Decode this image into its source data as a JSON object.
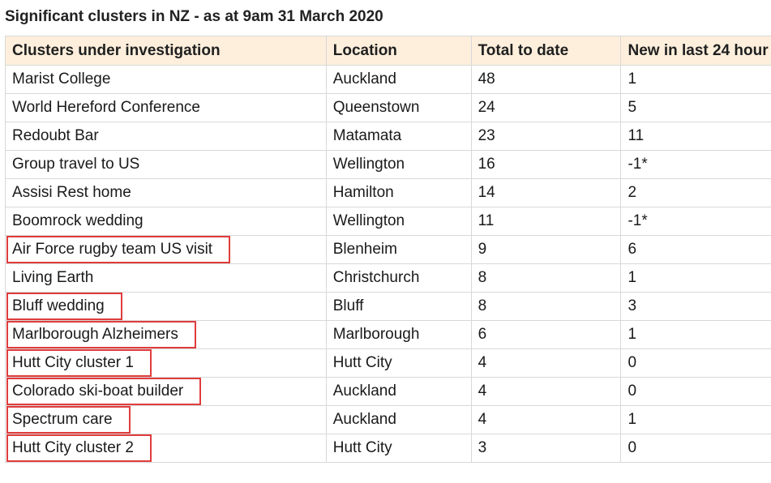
{
  "title": "Significant clusters in NZ - as at 9am 31 March 2020",
  "table": {
    "headers": [
      "Clusters under investigation",
      "Location",
      "Total to date",
      "New in last 24 hour"
    ],
    "rows": [
      {
        "name": "Marist College",
        "location": "Auckland",
        "total": "48",
        "new": "1",
        "highlighted": false
      },
      {
        "name": "World Hereford Conference",
        "location": "Queenstown",
        "total": "24",
        "new": "5",
        "highlighted": false
      },
      {
        "name": "Redoubt Bar",
        "location": "Matamata",
        "total": "23",
        "new": "11",
        "highlighted": false
      },
      {
        "name": "Group travel to US",
        "location": "Wellington",
        "total": "16",
        "new": "-1*",
        "highlighted": false
      },
      {
        "name": "Assisi Rest home",
        "location": "Hamilton",
        "total": "14",
        "new": "2",
        "highlighted": false
      },
      {
        "name": "Boomrock wedding",
        "location": "Wellington",
        "total": "11",
        "new": "-1*",
        "highlighted": false
      },
      {
        "name": "Air Force rugby team US visit",
        "location": "Blenheim",
        "total": "9",
        "new": "6",
        "highlighted": true
      },
      {
        "name": "Living Earth",
        "location": "Christchurch",
        "total": "8",
        "new": "1",
        "highlighted": false
      },
      {
        "name": "Bluff wedding",
        "location": "Bluff",
        "total": "8",
        "new": "3",
        "highlighted": true
      },
      {
        "name": "Marlborough Alzheimers",
        "location": "Marlborough",
        "total": "6",
        "new": "1",
        "highlighted": true
      },
      {
        "name": "Hutt City cluster 1",
        "location": "Hutt City",
        "total": "4",
        "new": "0",
        "highlighted": true
      },
      {
        "name": "Colorado ski-boat builder",
        "location": "Auckland",
        "total": "4",
        "new": "0",
        "highlighted": true
      },
      {
        "name": "Spectrum care",
        "location": "Auckland",
        "total": "4",
        "new": "1",
        "highlighted": true
      },
      {
        "name": "Hutt City cluster 2",
        "location": "Hutt City",
        "total": "3",
        "new": "0",
        "highlighted": true
      }
    ]
  },
  "colors": {
    "header_bg": "#fdefdc",
    "highlight_border": "#e03c3c",
    "grid": "#d8d8d8"
  }
}
